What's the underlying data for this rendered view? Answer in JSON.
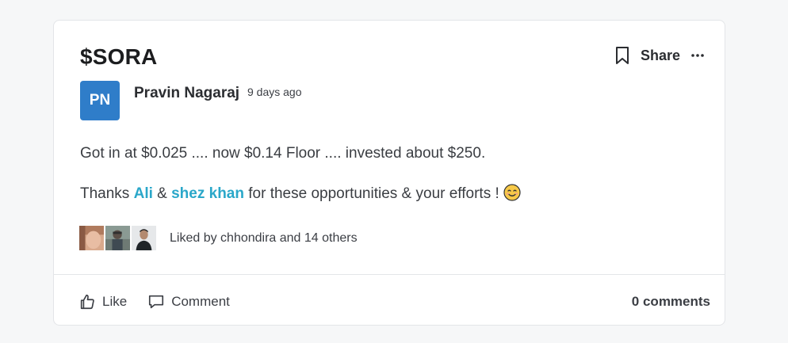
{
  "post": {
    "title": "$SORA",
    "actions": {
      "share_label": "Share",
      "bookmark_icon": "bookmark-icon",
      "more_icon": "more-horizontal-icon"
    },
    "author": {
      "initials": "PN",
      "name": "Pravin Nagaraj",
      "time_ago": "9 days ago",
      "avatar_color": "#2f7dc9"
    },
    "body": {
      "line1": "Got in at $0.025 .... now $0.14 Floor .... invested about $250.",
      "line2": {
        "prefix": "Thanks ",
        "mention1": "Ali",
        "between": " & ",
        "mention2": "shez khan",
        "suffix": " for these opportunities & your efforts ! ",
        "emoji": "smiling-face-emoji"
      }
    },
    "likes": {
      "text": "Liked by chhondira and 14 others",
      "avatars": [
        "liker-avatar-1",
        "liker-avatar-2",
        "liker-avatar-3"
      ]
    },
    "footer": {
      "like_label": "Like",
      "comment_label": "Comment",
      "comment_count": "0 comments"
    }
  },
  "colors": {
    "mention": "#2aa7c9",
    "background": "#f6f7f8",
    "card": "#ffffff"
  }
}
